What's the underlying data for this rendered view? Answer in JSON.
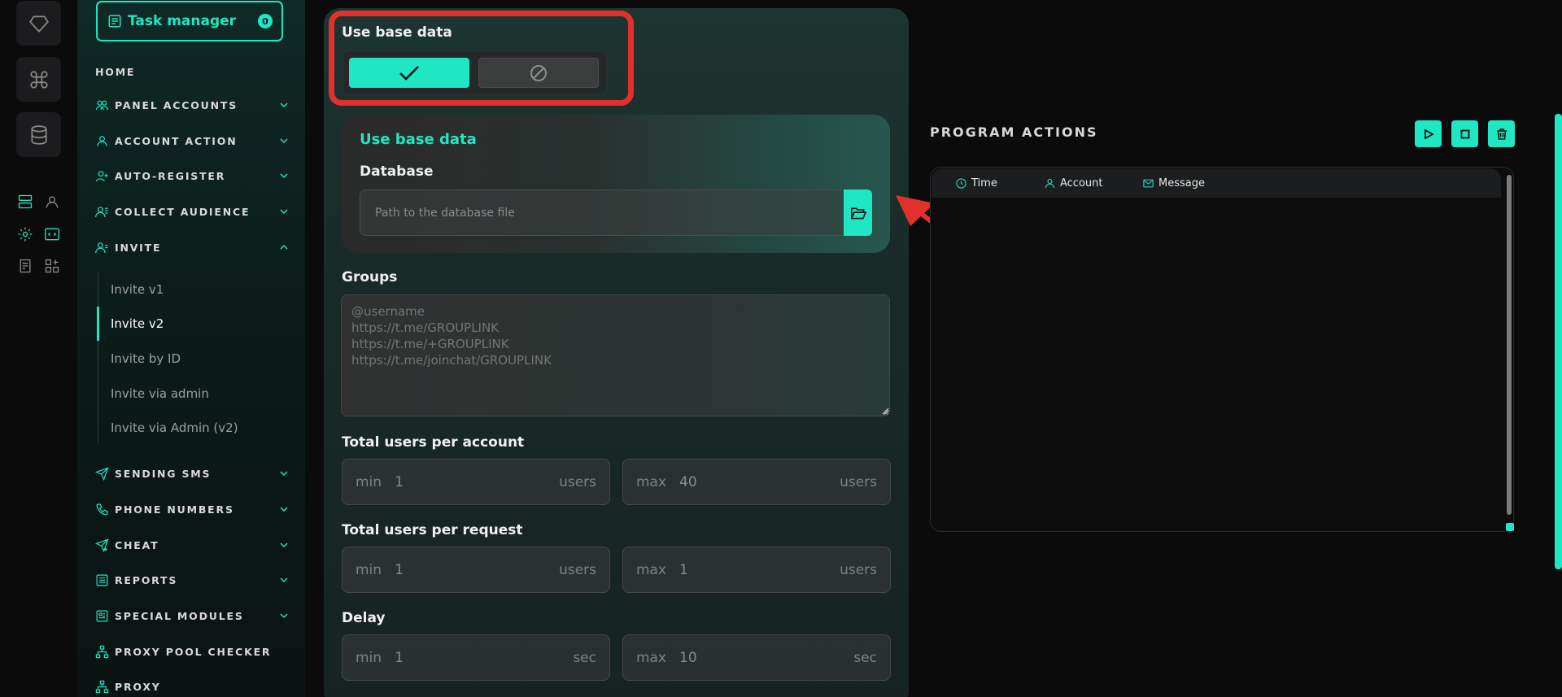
{
  "sidebar": {
    "task_manager": {
      "label": "Task manager",
      "count": "0"
    },
    "items": [
      {
        "label": "HOME"
      },
      {
        "label": "PANEL ACCOUNTS"
      },
      {
        "label": "ACCOUNT ACTION"
      },
      {
        "label": "AUTO-REGISTER"
      },
      {
        "label": "COLLECT AUDIENCE"
      },
      {
        "label": "INVITE"
      },
      {
        "label": "SENDING SMS"
      },
      {
        "label": "PHONE NUMBERS"
      },
      {
        "label": "CHEAT"
      },
      {
        "label": "REPORTS"
      },
      {
        "label": "SPECIAL MODULES"
      },
      {
        "label": "PROXY POOL CHECKER"
      },
      {
        "label": "PROXY"
      }
    ],
    "invite_sub": [
      "Invite v1",
      "Invite v2",
      "Invite by ID",
      "Invite via admin",
      "Invite via Admin (v2)"
    ],
    "active_sub": "Invite v2"
  },
  "form": {
    "use_base_label": "Use base data",
    "db_card_title": "Use base data",
    "database_label": "Database",
    "database_placeholder": "Path to the database file",
    "groups_label": "Groups",
    "groups_placeholder": "@username\nhttps://t.me/GROUPLINK\nhttps://t.me/+GROUPLINK\nhttps://t.me/joinchat/GROUPLINK",
    "total_per_account": {
      "label": "Total users per account",
      "min_prefix": "min",
      "min": "1",
      "max_prefix": "max",
      "max": "40",
      "unit": "users"
    },
    "total_per_request": {
      "label": "Total users per request",
      "min_prefix": "min",
      "min": "1",
      "max_prefix": "max",
      "max": "1",
      "unit": "users"
    },
    "delay": {
      "label": "Delay",
      "min_prefix": "min",
      "min": "1",
      "max_prefix": "max",
      "max": "10",
      "unit": "sec"
    }
  },
  "program_actions": {
    "title": "PROGRAM ACTIONS",
    "columns": [
      "Time",
      "Account",
      "Message"
    ]
  },
  "colors": {
    "accent": "#1fe6c3",
    "highlight": "#e4302b",
    "background": "#0b0b0c"
  }
}
